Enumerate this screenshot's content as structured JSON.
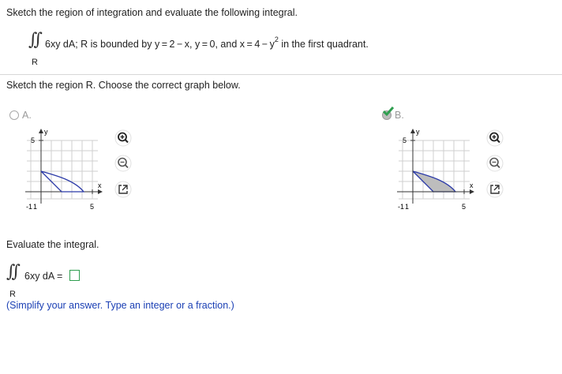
{
  "question": {
    "prompt": "Sketch the region of integration and evaluate the following integral.",
    "integral_rest": "6xy dA; R is bounded by y = 2 − x, y = 0, and x = 4 − y",
    "exponent": "2",
    "integral_tail": " in the first quadrant.",
    "region_label": "R"
  },
  "part1": {
    "prompt": "Sketch the region R. Choose the correct graph below.",
    "options": [
      {
        "letter": "A.",
        "selected": false,
        "y_label": "y",
        "x_label": "x",
        "tick_top": "5",
        "tick_left": "-1",
        "tick_origin": "1",
        "tick_right": "5",
        "shaded": false
      },
      {
        "letter": "B.",
        "selected": true,
        "y_label": "y",
        "x_label": "x",
        "tick_top": "5",
        "tick_left": "-1",
        "tick_origin": "1",
        "tick_right": "5",
        "shaded": true
      }
    ]
  },
  "part2": {
    "prompt": "Evaluate the integral.",
    "integrand": "6xy dA =",
    "region_label": "R",
    "answer_value": "",
    "hint": "(Simplify your answer. Type an integer or a fraction.)"
  },
  "tools": {
    "zoom_in": "zoom-in-icon",
    "zoom_out": "zoom-out-icon",
    "popout": "popout-icon"
  },
  "colors": {
    "check_green": "#2e9e4f",
    "region_fill": "#bdbdbd",
    "curve_blue": "#2b3aa8",
    "hint_blue": "#1a3fb4"
  }
}
